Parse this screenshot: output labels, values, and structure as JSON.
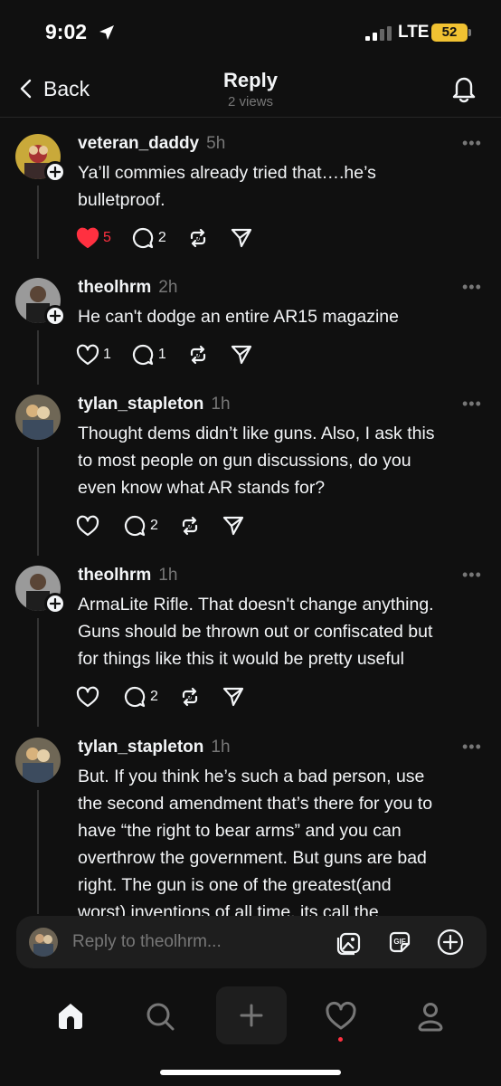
{
  "status": {
    "time": "9:02",
    "network": "LTE",
    "battery": "52"
  },
  "nav": {
    "back_label": "Back",
    "title": "Reply",
    "views": "2 views"
  },
  "posts": [
    {
      "username": "veteran_daddy",
      "time": "5h",
      "lines": [
        "Ya’ll commies already tried that….he’s",
        "bulletproof."
      ],
      "likes": "5",
      "liked": true,
      "replies": "2"
    },
    {
      "username": "theolhrm",
      "time": "2h",
      "lines": [
        "He can't dodge an entire AR15 magazine"
      ],
      "likes": "1",
      "liked": false,
      "replies": "1"
    },
    {
      "username": "tylan_stapleton",
      "time": "1h",
      "lines": [
        "Thought dems didn’t like guns. Also, I ask this",
        "to most people on gun discussions, do you",
        "even know what AR stands for?"
      ],
      "likes": "",
      "liked": false,
      "replies": "2"
    },
    {
      "username": "theolhrm",
      "time": "1h",
      "lines": [
        "ArmaLite Rifle. That doesn't change anything.",
        "Guns should be thrown out or confiscated but",
        "for things like this it would be pretty useful"
      ],
      "likes": "",
      "liked": false,
      "replies": "2"
    },
    {
      "username": "tylan_stapleton",
      "time": "1h",
      "lines": [
        "But. If you think he’s such a bad person, use",
        "the second amendment that’s there for you to",
        "have “the right to bear arms” and you can",
        "overthrow the government. But guns are bad",
        "right. The gun is one of the greatest(and",
        "worst) inventions of all time, its call the"
      ]
    }
  ],
  "more_glyph": "•••",
  "reply_bar": {
    "placeholder": "Reply to theolhrm..."
  },
  "icons": {
    "status": [
      "location-arrow-icon",
      "signal-icon",
      "battery-icon"
    ],
    "nav": [
      "chevron-left-icon",
      "bell-icon"
    ],
    "actions": [
      "heart-icon",
      "comment-icon",
      "repost-icon",
      "share-icon"
    ],
    "reply_bar": [
      "image-icon",
      "gif-icon",
      "plus-circle-icon"
    ],
    "tabs": [
      "home-icon",
      "search-icon",
      "plus-icon",
      "heart-icon",
      "profile-icon"
    ]
  },
  "colors": {
    "background": "#101010",
    "accent_red": "#ff3040",
    "battery": "#f1c232",
    "muted": "#777777"
  }
}
